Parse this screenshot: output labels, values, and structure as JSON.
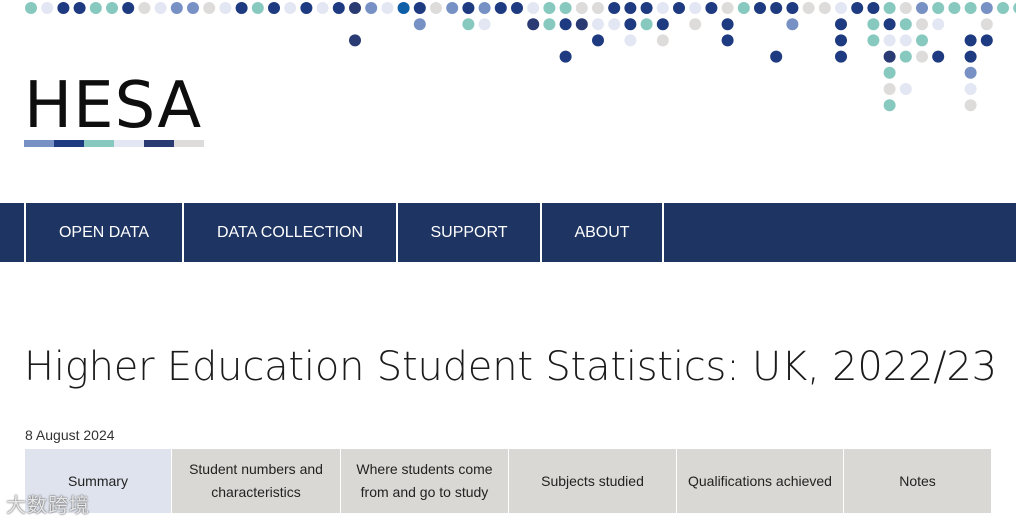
{
  "brand": {
    "logo_text": "HESA",
    "stripe_colors": [
      "#7891c5",
      "#1e3a80",
      "#88c9bf",
      "#e3e7f3",
      "#2a3a72",
      "#dedcdb"
    ],
    "dot_colors": [
      "#1e3a80",
      "#7891c5",
      "#88c9bf",
      "#e3e7f3",
      "#dedcdb",
      "#2a3a72",
      "#0f5ea8"
    ]
  },
  "nav": {
    "items": [
      {
        "label": "OPEN DATA"
      },
      {
        "label": "DATA COLLECTION"
      },
      {
        "label": "SUPPORT"
      },
      {
        "label": "ABOUT"
      }
    ],
    "background": "#1e3563"
  },
  "page": {
    "title": "Higher Education Student Statistics: UK, 2022/23",
    "date": "8 August 2024"
  },
  "tabs": [
    {
      "label": "Summary",
      "active": true
    },
    {
      "label": "Student numbers and characteristics"
    },
    {
      "label": "Where students come from and go to study"
    },
    {
      "label": "Subjects studied"
    },
    {
      "label": "Qualifications achieved"
    },
    {
      "label": "Notes"
    }
  ],
  "watermark": "大数跨境"
}
